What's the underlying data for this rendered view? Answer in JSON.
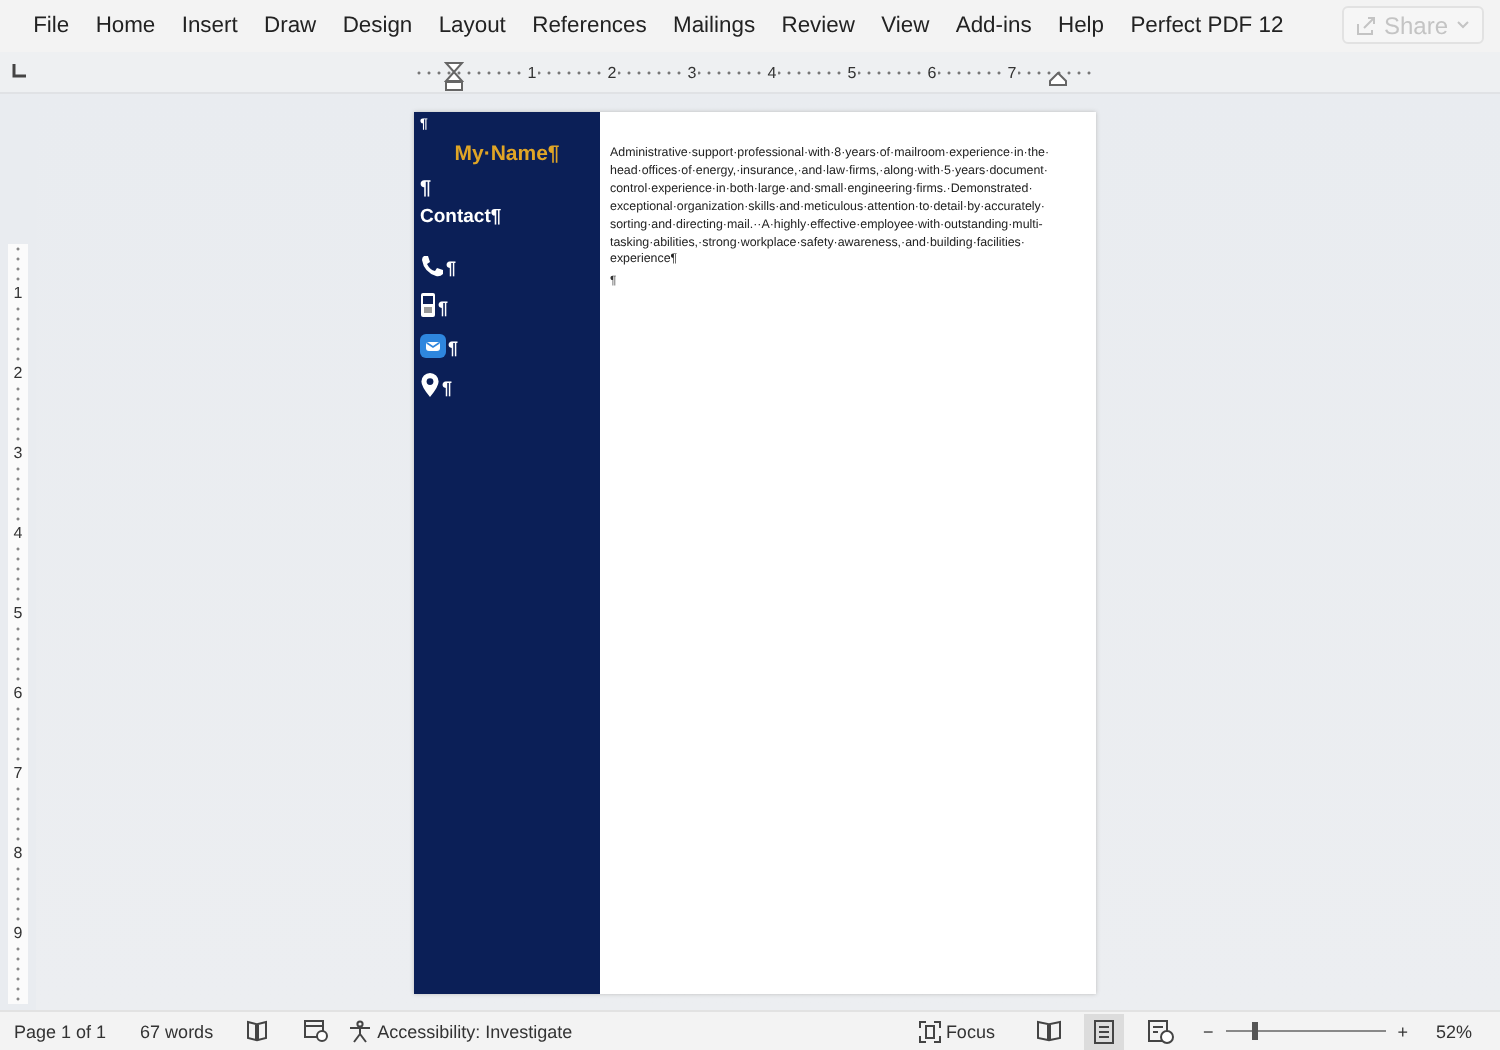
{
  "menu": [
    "File",
    "Home",
    "Insert",
    "Draw",
    "Design",
    "Layout",
    "References",
    "Mailings",
    "Review",
    "View",
    "Add-ins",
    "Help",
    "Perfect PDF 12"
  ],
  "share_button": {
    "label": "Share",
    "disabled": true
  },
  "ruler": {
    "numbers": [
      "1",
      "2",
      "3",
      "4",
      "5",
      "6",
      "7"
    ]
  },
  "vertical_ruler": {
    "numbers": [
      "1",
      "2",
      "3",
      "4",
      "5",
      "6",
      "7",
      "8",
      "9"
    ]
  },
  "document": {
    "sidebar": {
      "top_mark": "¶",
      "name": "My·Name¶",
      "blank_mark": "¶",
      "contact_heading": "Contact¶",
      "contacts": [
        {
          "kind": "phone",
          "mark": "¶"
        },
        {
          "kind": "mobile",
          "mark": "¶"
        },
        {
          "kind": "email",
          "mark": "¶"
        },
        {
          "kind": "location",
          "mark": "¶"
        }
      ]
    },
    "summary": "Administrative·support·professional·with·8·years·of·mailroom·experience·in·the·head·offices·of·energy,·insurance,·and·law·firms,·along·with·5·years·document·control·experience·in·both·large·and·small·engineering·firms.·Demonstrated·exceptional·organization·skills·and·meticulous·attention·to·detail·by·accurately·sorting·and·directing·mail.··A·highly·effective·employee·with·outstanding·multi-tasking·abilities,·strong·workplace·safety·awareness,·and·building·facilities·experience¶",
    "end_mark": "¶"
  },
  "status_bar": {
    "page": "Page 1 of 1",
    "words": "67 words",
    "accessibility": "Accessibility: Investigate",
    "focus": "Focus",
    "views": [
      {
        "kind": "read",
        "selected": false
      },
      {
        "kind": "print",
        "selected": true
      },
      {
        "kind": "web",
        "selected": false
      }
    ],
    "zoom_minus": "−",
    "zoom_plus": "+",
    "zoom_slider": {
      "level": 0.17
    },
    "zoom": "52%"
  }
}
